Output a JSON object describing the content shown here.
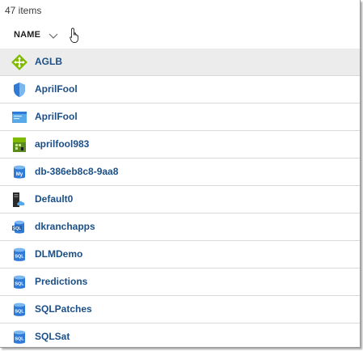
{
  "header": {
    "item_count": "47 items",
    "name_column": "NAME"
  },
  "items": [
    {
      "label": "AGLB",
      "icon": "traffic-manager-icon",
      "selected": true
    },
    {
      "label": "AprilFool",
      "icon": "shield-icon"
    },
    {
      "label": "AprilFool",
      "icon": "web-app-window-icon"
    },
    {
      "label": "aprilfool983",
      "icon": "storage-account-icon"
    },
    {
      "label": "db-386eb8c8-9aa8",
      "icon": "mysql-database-icon"
    },
    {
      "label": "Default0",
      "icon": "cloud-server-icon"
    },
    {
      "label": "dkranchapps",
      "icon": "sql-server-icon"
    },
    {
      "label": "DLMDemo",
      "icon": "sql-database-icon"
    },
    {
      "label": "Predictions",
      "icon": "sql-database-icon"
    },
    {
      "label": "SQLPatches",
      "icon": "sql-database-icon"
    },
    {
      "label": "SQLSat",
      "icon": "sql-database-icon"
    }
  ],
  "colors": {
    "link_text": "#1c4f86",
    "selected_row": "#ececec",
    "azure_blue": "#2f7ad6",
    "green": "#7fba00"
  }
}
